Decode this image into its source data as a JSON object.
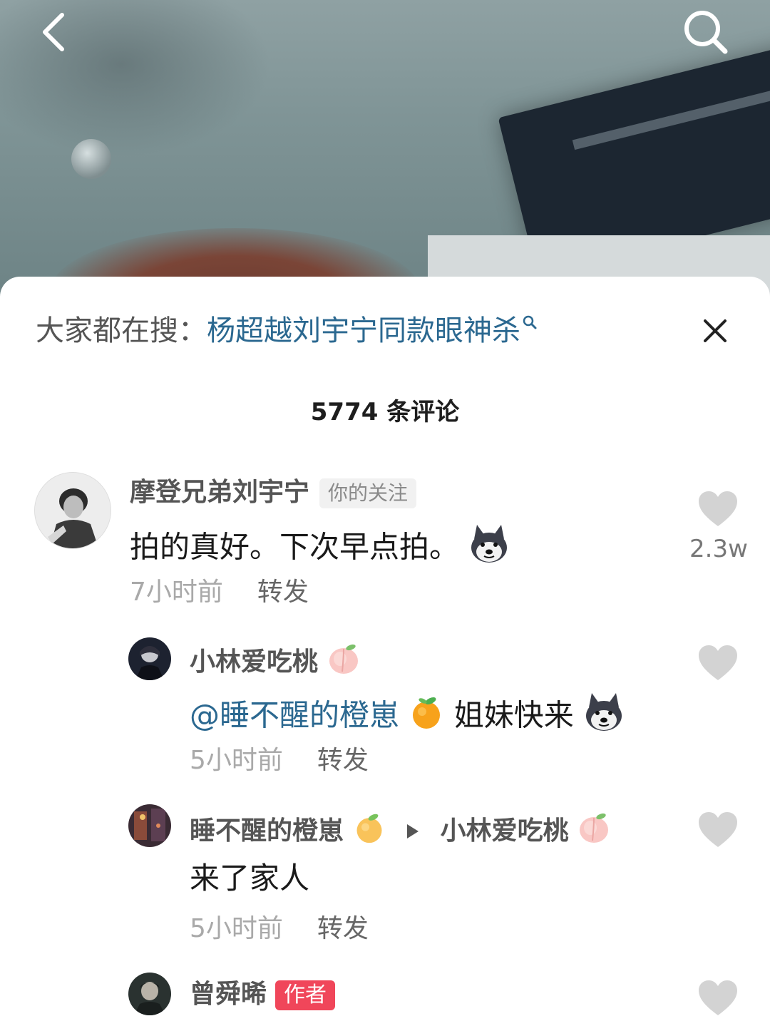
{
  "nav": {
    "back_icon": "chevron-left-icon",
    "search_icon": "search-icon"
  },
  "hot_search": {
    "prefix": "大家都在搜：",
    "topic": "杨超越刘宇宁同款眼神杀",
    "close_icon": "close-icon"
  },
  "comment_count_label": "5774 条评论",
  "comments": [
    {
      "username": "摩登兄弟刘宇宁",
      "badge": "你的关注",
      "text": "拍的真好。下次早点拍。",
      "emoji": "husky-emoji",
      "time": "7小时前",
      "share": "转发",
      "likes": "2.3w"
    },
    {
      "username": "小林爱吃桃",
      "name_emoji": "peach-emoji",
      "mention": "@睡不醒的橙崽",
      "mention_emoji": "tangerine-emoji",
      "text": "姐妹快来",
      "emoji": "husky-emoji",
      "time": "5小时前",
      "share": "转发"
    },
    {
      "username": "睡不醒的橙崽",
      "name_emoji": "tangerine-emoji",
      "reply_to": "小林爱吃桃",
      "reply_to_emoji": "peach-emoji",
      "text": "来了家人",
      "time": "5小时前",
      "share": "转发"
    },
    {
      "username": "曾舜晞",
      "badge": "作者"
    }
  ],
  "colors": {
    "link_blue": "#2b6890",
    "author_badge": "#f0465a",
    "heart_gray": "#cfcfcf"
  }
}
